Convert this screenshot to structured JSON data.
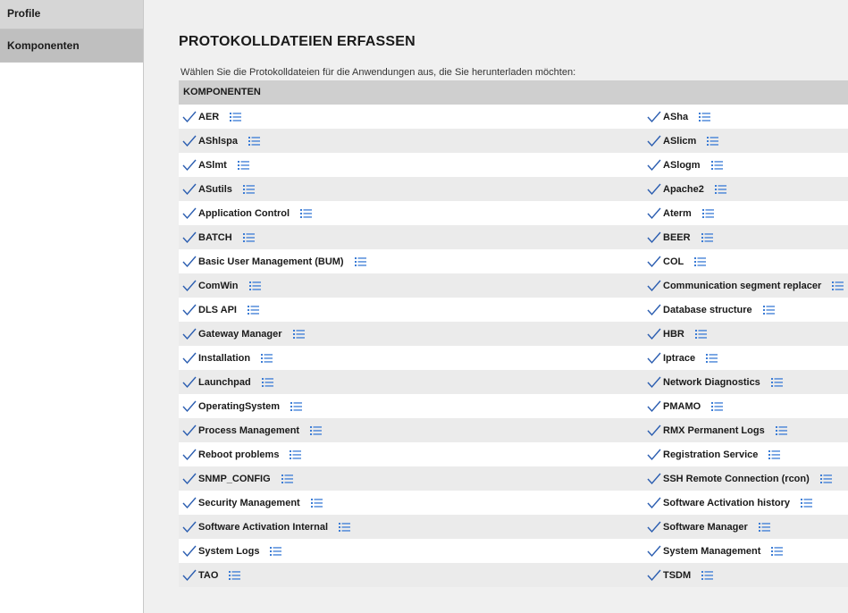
{
  "sidebar": {
    "items": [
      {
        "label": "Profile"
      },
      {
        "label": "Komponenten"
      }
    ]
  },
  "main": {
    "title": "PROTOKOLLDATEIEN ERFASSEN",
    "subtitle": "Wählen Sie die Protokolldateien für die Anwendungen aus, die Sie herunterladen möchten:",
    "table_header": "KOMPONENTEN",
    "rows": [
      {
        "left": "AER",
        "right": "ASha"
      },
      {
        "left": "AShlspa",
        "right": "ASlicm"
      },
      {
        "left": "ASlmt",
        "right": "ASlogm"
      },
      {
        "left": "ASutils",
        "right": "Apache2"
      },
      {
        "left": "Application Control",
        "right": "Aterm"
      },
      {
        "left": "BATCH",
        "right": "BEER"
      },
      {
        "left": "Basic User Management (BUM)",
        "right": "COL"
      },
      {
        "left": "ComWin",
        "right": "Communication segment replacer"
      },
      {
        "left": "DLS API",
        "right": "Database structure"
      },
      {
        "left": "Gateway Manager",
        "right": "HBR"
      },
      {
        "left": "Installation",
        "right": "Iptrace"
      },
      {
        "left": "Launchpad",
        "right": "Network Diagnostics"
      },
      {
        "left": "OperatingSystem",
        "right": "PMAMO"
      },
      {
        "left": "Process Management",
        "right": "RMX Permanent Logs"
      },
      {
        "left": "Reboot problems",
        "right": "Registration Service"
      },
      {
        "left": "SNMP_CONFIG",
        "right": "SSH Remote Connection (rcon)"
      },
      {
        "left": "Security Management",
        "right": "Software Activation history"
      },
      {
        "left": "Software Activation Internal",
        "right": "Software Manager"
      },
      {
        "left": "System Logs",
        "right": "System Management"
      },
      {
        "left": "TAO",
        "right": "TSDM"
      }
    ]
  },
  "colors": {
    "accent_icon": "#3a7bd5",
    "checkmark": "#2a5db0"
  }
}
